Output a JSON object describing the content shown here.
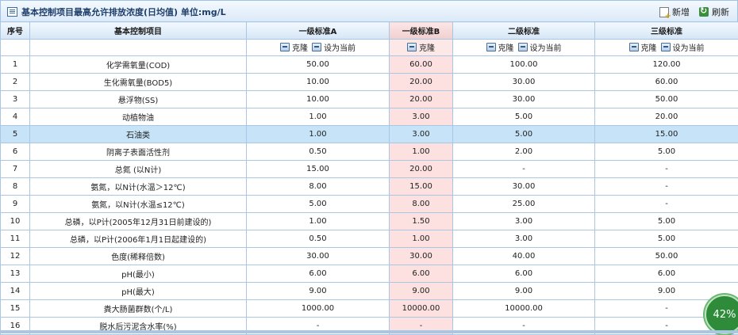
{
  "header": {
    "title": "基本控制项目最高允许排放浓度(日均值) 单位:mg/L",
    "add_label": "新增",
    "refresh_label": "刷新"
  },
  "columns": [
    "序号",
    "基本控制项目",
    "一级标准A",
    "一级标准B",
    "二级标准",
    "三级标准"
  ],
  "ops": {
    "clone": "克隆",
    "set_current": "设为当前"
  },
  "rows": [
    {
      "no": "1",
      "item": "化学需氧量(COD)",
      "a": "50.00",
      "b": "60.00",
      "c": "100.00",
      "d": "120.00"
    },
    {
      "no": "2",
      "item": "生化需氧量(BOD5)",
      "a": "10.00",
      "b": "20.00",
      "c": "30.00",
      "d": "60.00"
    },
    {
      "no": "3",
      "item": "悬浮物(SS)",
      "a": "10.00",
      "b": "20.00",
      "c": "30.00",
      "d": "50.00"
    },
    {
      "no": "4",
      "item": "动植物油",
      "a": "1.00",
      "b": "3.00",
      "c": "5.00",
      "d": "20.00"
    },
    {
      "no": "5",
      "item": "石油类",
      "a": "1.00",
      "b": "3.00",
      "c": "5.00",
      "d": "15.00"
    },
    {
      "no": "6",
      "item": "阴离子表面活性剂",
      "a": "0.50",
      "b": "1.00",
      "c": "2.00",
      "d": "5.00"
    },
    {
      "no": "7",
      "item": "总氮 (以N计)",
      "a": "15.00",
      "b": "20.00",
      "c": "-",
      "d": "-"
    },
    {
      "no": "8",
      "item": "氨氮，以N计(水温＞12℃)",
      "a": "8.00",
      "b": "15.00",
      "c": "30.00",
      "d": "-"
    },
    {
      "no": "9",
      "item": "氨氮，以N计(水温≤12℃)",
      "a": "5.00",
      "b": "8.00",
      "c": "25.00",
      "d": "-"
    },
    {
      "no": "10",
      "item": "总磷，以P计(2005年12月31日前建设的)",
      "a": "1.00",
      "b": "1.50",
      "c": "3.00",
      "d": "5.00"
    },
    {
      "no": "11",
      "item": "总磷，以P计(2006年1月1日起建设的)",
      "a": "0.50",
      "b": "1.00",
      "c": "3.00",
      "d": "5.00"
    },
    {
      "no": "12",
      "item": "色度(稀释倍数)",
      "a": "30.00",
      "b": "30.00",
      "c": "40.00",
      "d": "50.00"
    },
    {
      "no": "13",
      "item": "pH(最小)",
      "a": "6.00",
      "b": "6.00",
      "c": "6.00",
      "d": "6.00"
    },
    {
      "no": "14",
      "item": "pH(最大)",
      "a": "9.00",
      "b": "9.00",
      "c": "9.00",
      "d": "9.00"
    },
    {
      "no": "15",
      "item": "粪大肠菌群数(个/L)",
      "a": "1000.00",
      "b": "10000.00",
      "c": "10000.00",
      "d": "-"
    },
    {
      "no": "16",
      "item": "脱水后污泥含水率(%)",
      "a": "-",
      "b": "-",
      "c": "-",
      "d": "-"
    }
  ],
  "selected_row": 5,
  "progress": {
    "value": 0.42,
    "label": "42%"
  },
  "colors": {
    "header_border": "#a9c6e4",
    "selected_row": "#c6e3f7",
    "col_b_bg": "#fde0e0",
    "progress_bg": "#2e8b3a"
  }
}
